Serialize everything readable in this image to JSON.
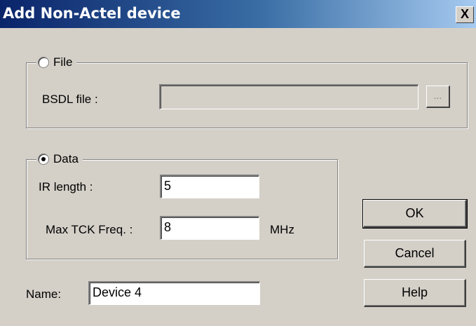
{
  "window": {
    "title": "Add Non-Actel device",
    "close_label": "X"
  },
  "file_group": {
    "legend": "File",
    "selected": false,
    "bsdl_label": "BSDL file :",
    "bsdl_value": "",
    "browse_label": "..."
  },
  "data_group": {
    "legend": "Data",
    "selected": true,
    "ir_length_label": "IR length :",
    "ir_length_value": "5",
    "max_tck_label": "Max TCK Freq. :",
    "max_tck_value": "8",
    "max_tck_unit": "MHz"
  },
  "name_field": {
    "label": "Name:",
    "value": "Device 4"
  },
  "buttons": {
    "ok": "OK",
    "cancel": "Cancel",
    "help": "Help"
  }
}
